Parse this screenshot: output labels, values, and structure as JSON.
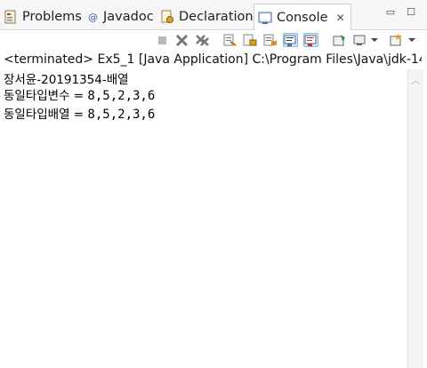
{
  "tabs": [
    {
      "label": "Problems",
      "icon": "problems-icon"
    },
    {
      "label": "Javadoc",
      "icon": "javadoc-icon"
    },
    {
      "label": "Declaration",
      "icon": "declaration-icon"
    },
    {
      "label": "Console",
      "icon": "console-icon",
      "active": true
    }
  ],
  "console_close": "✕",
  "window_controls": {
    "minimize": "▭",
    "maximize": "☐"
  },
  "toolbar_icons": [
    "terminate-icon",
    "remove-launch-icon",
    "remove-all-terminated-icon",
    "clear-console-icon",
    "scroll-lock-icon",
    "word-wrap-icon",
    "show-console-on-stdout-icon",
    "show-console-on-stderr-icon",
    "pin-console-icon",
    "display-selected-console-icon",
    "open-console-icon"
  ],
  "status": "<terminated> Ex5_1 [Java Application] C:\\Program Files\\Java\\jdk-14",
  "output": {
    "line1": "장서윤-20191354-배열",
    "line2_label": "동일타입변수 = ",
    "line2_values": "8,5,2,3,6",
    "line3_label": "동일타입배열 = ",
    "line3_values": "8,5,2,3,6"
  },
  "colors": {
    "accent": "#2b6cb0",
    "pressed": "#d6e6f6"
  }
}
